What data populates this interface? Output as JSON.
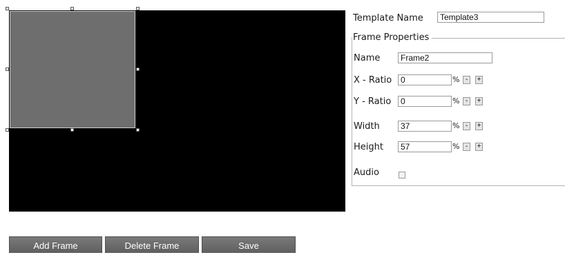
{
  "template": {
    "name_label": "Template Name",
    "name_value": "Template3"
  },
  "frame_properties": {
    "legend": "Frame Properties",
    "name_label": "Name",
    "name_value": "Frame2",
    "x_ratio_label": "X - Ratio",
    "x_ratio_value": "0",
    "y_ratio_label": "Y - Ratio",
    "y_ratio_value": "0",
    "width_label": "Width",
    "width_value": "37",
    "height_label": "Height",
    "height_value": "57",
    "percent_symbol": "%",
    "minus_label": "-",
    "plus_label": "+",
    "audio_label": "Audio"
  },
  "buttons": {
    "add_frame": "Add Frame",
    "delete_frame": "Delete Frame",
    "save": "Save"
  }
}
